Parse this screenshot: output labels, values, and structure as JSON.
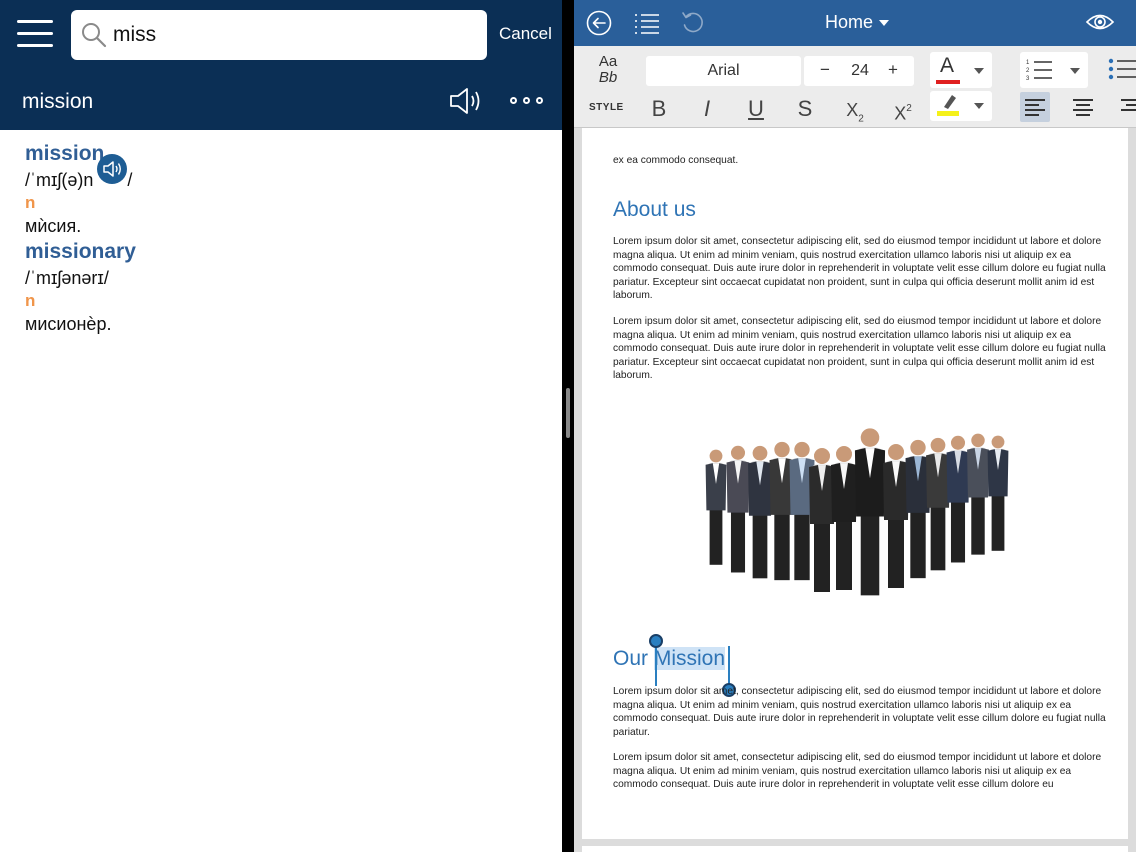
{
  "dictionary": {
    "search": {
      "value": "miss"
    },
    "cancel_label": "Cancel",
    "headword": "mission",
    "entries": [
      {
        "word": "mission",
        "pron": "/ˈmɪʃ(ə)n",
        "pron_end": "/",
        "pos": "n",
        "translation": "мѝсия."
      },
      {
        "word": "missionary",
        "pron": "/ˈmɪʃənərɪ/",
        "pos": "n",
        "translation": "мисионѐр."
      }
    ]
  },
  "editor": {
    "header": {
      "home_label": "Home"
    },
    "ribbon": {
      "style_aa": "Aa",
      "style_bb": "Bb",
      "style_label": "STYLE",
      "font": "Arial",
      "size": "24",
      "minus": "−",
      "plus": "+",
      "bold": "B",
      "italic": "I",
      "underline": "U",
      "strike": "S",
      "subscript": "X",
      "subscript_mark": "2",
      "superscript": "X",
      "superscript_mark": "2",
      "font_color_letter": "A",
      "font_color": "#e02020",
      "highlight_color": "#f5f11a",
      "list_numbers": [
        "1",
        "2",
        "3"
      ]
    },
    "document": {
      "top_line": "ex ea commodo consequat.",
      "heading_about": "About us",
      "lorem_1": "Lorem ipsum dolor sit amet, consectetur adipiscing elit, sed do eiusmod tempor incididunt ut labore et dolore magna aliqua. Ut enim ad minim veniam, quis nostrud exercitation ullamco laboris nisi ut aliquip ex ea commodo consequat. Duis aute irure dolor in reprehenderit in voluptate velit esse cillum dolore eu fugiat nulla pariatur. Excepteur sint occaecat cupidatat non proident, sunt in culpa qui officia deserunt mollit anim id est laborum.",
      "lorem_2": "Lorem ipsum dolor sit amet, consectetur adipiscing elit, sed do eiusmod tempor incididunt ut labore et dolore magna aliqua. Ut enim ad minim veniam, quis nostrud exercitation ullamco laboris nisi ut aliquip ex ea commodo consequat. Duis aute irure dolor in reprehenderit in voluptate velit esse cillum dolore eu fugiat nulla pariatur. Excepteur sint occaecat cupidatat non proident, sunt in culpa qui officia deserunt mollit anim id est laborum.",
      "heading_mission_prefix": "Our ",
      "heading_mission_selected": "Mission",
      "lorem_3": "Lorem ipsum dolor sit amet, consectetur adipiscing elit, sed do eiusmod tempor incididunt ut labore et dolore magna aliqua. Ut enim ad minim veniam, quis nostrud exercitation ullamco laboris nisi ut aliquip ex ea commodo consequat. Duis aute irure dolor in reprehenderit in voluptate velit esse cillum dolore eu fugiat nulla pariatur.",
      "lorem_4": "Lorem ipsum dolor sit amet, consectetur adipiscing elit, sed do eiusmod tempor incididunt ut labore et dolore magna aliqua. Ut enim ad minim veniam, quis nostrud exercitation ullamco laboris nisi ut aliquip ex ea commodo consequat. Duis aute irure dolor in reprehenderit in voluptate velit esse cillum dolore eu"
    }
  },
  "icons": [
    "menu-icon",
    "search-icon",
    "speaker-icon",
    "more-icon",
    "back-icon",
    "outline-icon",
    "undo-icon",
    "eye-icon",
    "team-photo"
  ]
}
